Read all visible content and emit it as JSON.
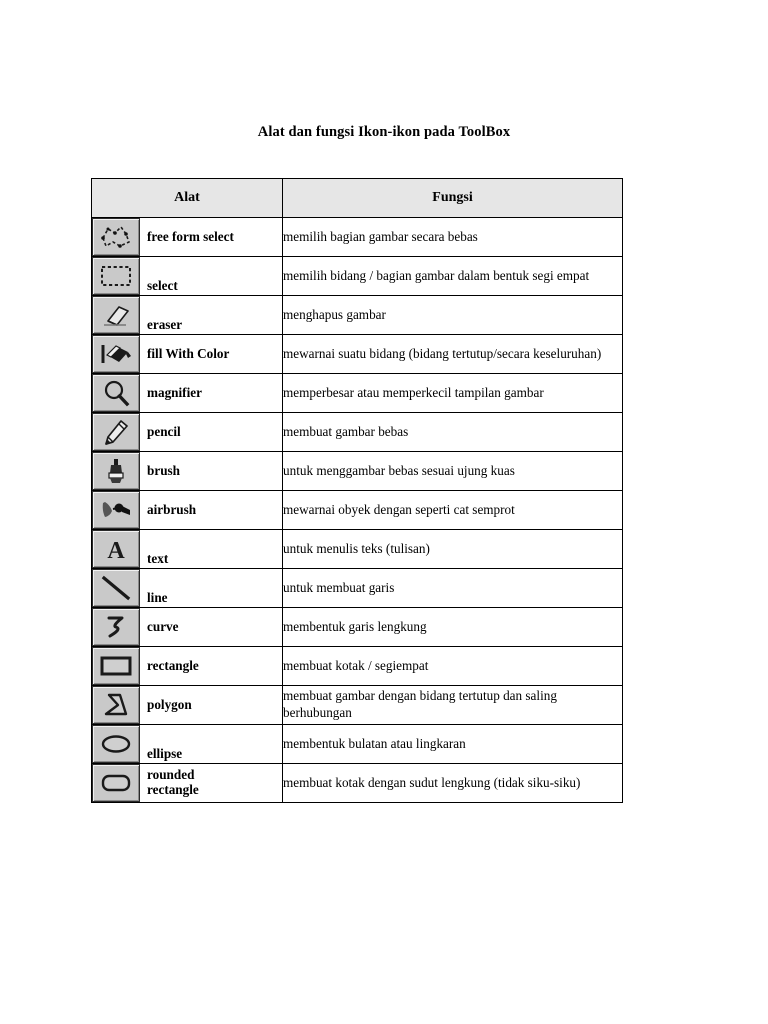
{
  "document": {
    "title": "Alat dan fungsi Ikon-ikon pada ToolBox"
  },
  "table": {
    "headers": {
      "tool": "Alat",
      "function": "Fungsi"
    },
    "rows": [
      {
        "icon": "free-form-select-icon",
        "tool": "free form select",
        "description": "memilih bagian gambar secara bebas"
      },
      {
        "icon": "select-icon",
        "tool": "select",
        "description": "memilih bidang / bagian gambar dalam bentuk segi empat"
      },
      {
        "icon": "eraser-icon",
        "tool": "eraser",
        "description": "menghapus gambar"
      },
      {
        "icon": "fill-with-color-icon",
        "tool": "fill With Color",
        "description": "mewarnai suatu bidang (bidang tertutup/secara keseluruhan)"
      },
      {
        "icon": "magnifier-icon",
        "tool": "magnifier",
        "description": "memperbesar atau memperkecil tampilan gambar"
      },
      {
        "icon": "pencil-icon",
        "tool": "pencil",
        "description": "membuat gambar bebas"
      },
      {
        "icon": "brush-icon",
        "tool": "brush",
        "description": "untuk menggambar bebas sesuai ujung kuas"
      },
      {
        "icon": "airbrush-icon",
        "tool": "airbrush",
        "description": "mewarnai obyek dengan seperti cat semprot"
      },
      {
        "icon": "text-icon",
        "tool": "text",
        "description": "untuk menulis teks (tulisan)"
      },
      {
        "icon": "line-icon",
        "tool": "line",
        "description": "untuk membuat garis"
      },
      {
        "icon": "curve-icon",
        "tool": "curve",
        "description": "membentuk garis lengkung"
      },
      {
        "icon": "rectangle-icon",
        "tool": "rectangle",
        "description": "membuat kotak / segiempat"
      },
      {
        "icon": "polygon-icon",
        "tool": "polygon",
        "description": "membuat gambar dengan bidang tertutup dan saling berhubungan"
      },
      {
        "icon": "ellipse-icon",
        "tool": "ellipse",
        "description": "membentuk bulatan atau lingkaran"
      },
      {
        "icon": "rounded-rectangle-icon",
        "tool": "rounded rectangle",
        "description": "membuat kotak dengan sudut lengkung (tidak siku-siku)"
      }
    ]
  },
  "colors": {
    "header_background": "#e6e6e6",
    "border": "#000000",
    "icon_face": "#c9c9c9",
    "text": "#000000"
  }
}
